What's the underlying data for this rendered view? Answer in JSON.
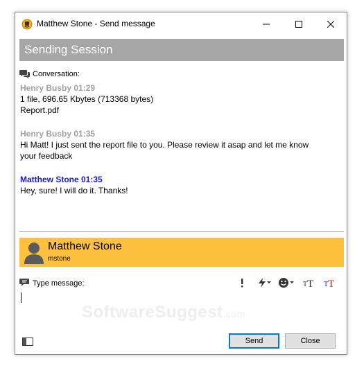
{
  "window": {
    "title": "Matthew Stone - Send message",
    "controls": [
      "minimize-icon",
      "maximize-icon",
      "close-icon"
    ]
  },
  "session": {
    "title": "Sending Session"
  },
  "conversation": {
    "label": "Conversation:",
    "messages": [
      {
        "sender": "Henry Busby",
        "time": "01:29",
        "header": "Henry Busby 01:29",
        "type": "other",
        "lines": [
          "1 file, 696.65 Kbytes (713368 bytes)",
          "Report.pdf"
        ]
      },
      {
        "sender": "Henry Busby",
        "time": "01:35",
        "header": "Henry Busby 01:35",
        "type": "other",
        "lines": [
          "Hi Matt! I just sent the report file to you. Please review it asap and let me know",
          "your feedback"
        ]
      },
      {
        "sender": "Matthew Stone",
        "time": "01:35",
        "header": "Matthew Stone 01:35",
        "type": "self",
        "lines": [
          "Hey, sure! I will do it. Thanks!"
        ]
      }
    ]
  },
  "contact": {
    "name": "Matthew Stone",
    "username": "mstone"
  },
  "compose": {
    "label": "Type message:",
    "value": "",
    "tools": [
      "exclamation-icon",
      "lightning-icon",
      "smiley-icon",
      "font-icon",
      "font-color-icon"
    ]
  },
  "watermark": {
    "main": "SoftwareSuggest",
    "suffix": ".com"
  },
  "buttons": {
    "send": "Send",
    "close": "Close"
  },
  "colors": {
    "session_bar": "#a6a6a6",
    "contact_bar": "#fdc03f",
    "other_sender": "#a0a0a0",
    "self_sender": "#1a1acd",
    "primary_border": "#0078d7"
  }
}
